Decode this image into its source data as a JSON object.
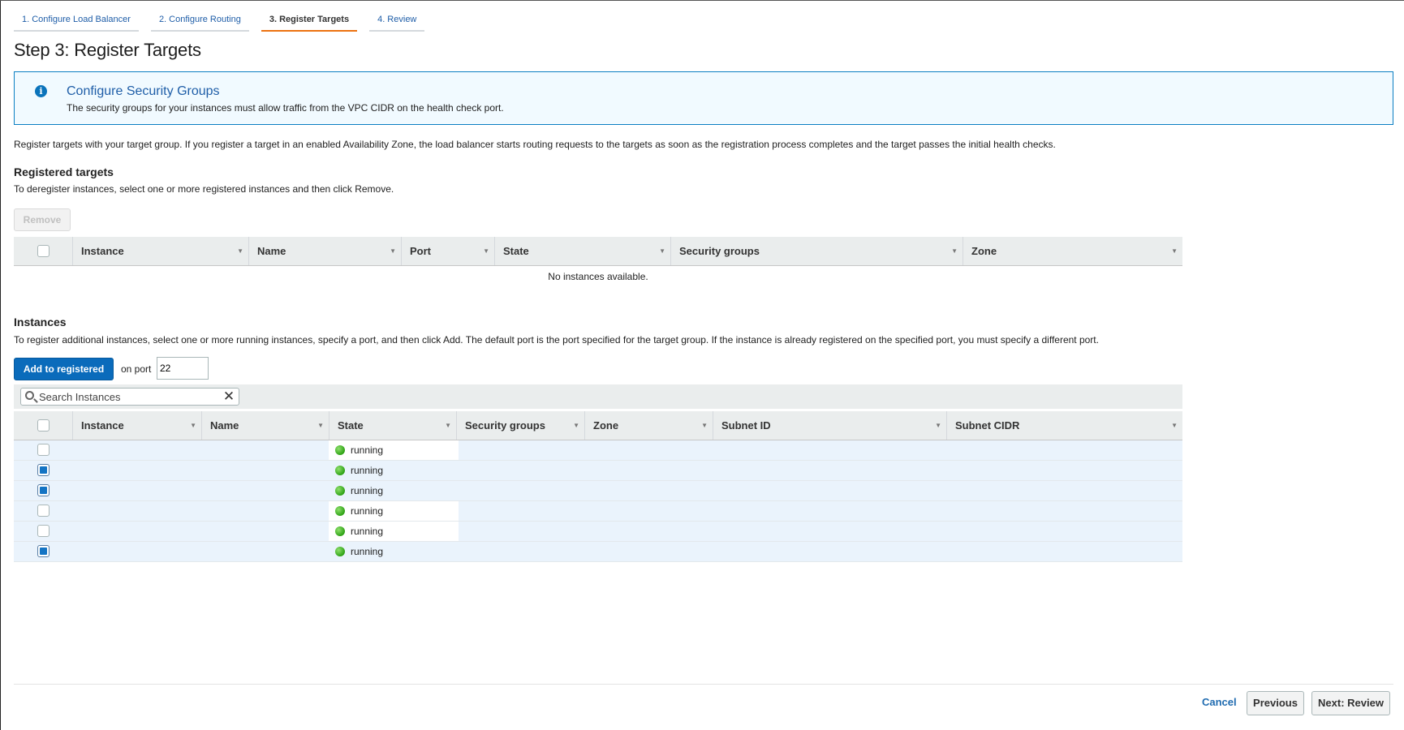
{
  "steps": [
    {
      "label": "1. Configure Load Balancer",
      "active": false
    },
    {
      "label": "2. Configure Routing",
      "active": false
    },
    {
      "label": "3. Register Targets",
      "active": true
    },
    {
      "label": "4. Review",
      "active": false
    }
  ],
  "page_title": "Step 3: Register Targets",
  "info": {
    "icon": "info-icon",
    "glyph": "i",
    "title": "Configure Security Groups",
    "text": "The security groups for your instances must allow traffic from the VPC CIDR on the health check port."
  },
  "intro": "Register targets with your target group. If you register a target in an enabled Availability Zone, the load balancer starts routing requests to the targets as soon as the registration process completes and the target passes the initial health checks.",
  "registered": {
    "title": "Registered targets",
    "description": "To deregister instances, select one or more registered instances and then click Remove.",
    "remove_label": "Remove",
    "columns": [
      "Instance",
      "Name",
      "Port",
      "State",
      "Security groups",
      "Zone"
    ],
    "empty_text": "No instances available."
  },
  "instances": {
    "title": "Instances",
    "description": "To register additional instances, select one or more running instances, specify a port, and then click Add. The default port is the port specified for the target group. If the instance is already registered on the specified port, you must specify a different port.",
    "add_label": "Add to registered",
    "port_label": "on port",
    "port_value": "22",
    "search_placeholder": "Search Instances",
    "columns": [
      "Instance",
      "Name",
      "State",
      "Security groups",
      "Zone",
      "Subnet ID",
      "Subnet CIDR"
    ],
    "rows": [
      {
        "checked": false,
        "state": "running"
      },
      {
        "checked": true,
        "state": "running"
      },
      {
        "checked": true,
        "state": "running"
      },
      {
        "checked": false,
        "state": "running"
      },
      {
        "checked": false,
        "state": "running"
      },
      {
        "checked": true,
        "state": "running"
      }
    ]
  },
  "footer": {
    "cancel": "Cancel",
    "previous": "Previous",
    "next": "Next: Review"
  },
  "colors": {
    "primary": "#0a6bbb",
    "active_tab": "#ec7211",
    "info_border": "#0a7ec2",
    "running": "#2ea215"
  }
}
